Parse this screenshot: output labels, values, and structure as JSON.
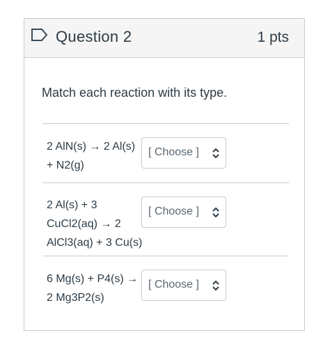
{
  "question": {
    "title": "Question 2",
    "points": "1 pts",
    "prompt": "Match each reaction with its type."
  },
  "rows": [
    {
      "reaction_lines": [
        "2 AlN(s) → 2 Al(s)",
        "+ N2(g)"
      ],
      "select_value": "[ Choose ]"
    },
    {
      "reaction_lines": [
        "2 Al(s) + 3",
        "CuCl2(aq) → 2",
        "AlCl3(aq) + 3 Cu(s)"
      ],
      "select_value": "[ Choose ]"
    },
    {
      "reaction_lines": [
        "6 Mg(s) + P4(s) →",
        "2 Mg3P2(s)"
      ],
      "select_value": "[ Choose ]"
    }
  ],
  "icons": {
    "flag": "flag-icon",
    "select_arrows": "chevron-up-down-icon"
  },
  "colors": {
    "text": "#2d3b45",
    "border": "#c7cdd1",
    "header_bg": "#f5f5f5",
    "flag": "#394b58"
  }
}
